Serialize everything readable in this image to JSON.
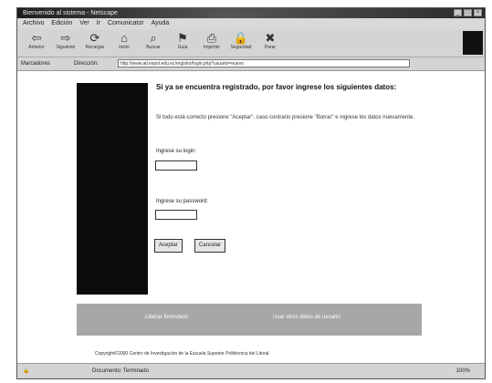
{
  "window": {
    "title": "Bienvenido al sistema - Netscape"
  },
  "menu": [
    "Archivo",
    "Edición",
    "Ver",
    "Ir",
    "Comunicator",
    "Ayuda"
  ],
  "toolbar": [
    {
      "icon": "back-icon",
      "label": "Anterior",
      "glyph": "⇦"
    },
    {
      "icon": "forward-icon",
      "label": "Siguiente",
      "glyph": "⇨"
    },
    {
      "icon": "reload-icon",
      "label": "Recargar",
      "glyph": "⟳"
    },
    {
      "icon": "home-icon",
      "label": "Inicio",
      "glyph": "⌂"
    },
    {
      "icon": "search-icon",
      "label": "Buscar",
      "glyph": "⌕"
    },
    {
      "icon": "guide-icon",
      "label": "Guía",
      "glyph": "⚑"
    },
    {
      "icon": "print-icon",
      "label": "Imprimir",
      "glyph": "⎙"
    },
    {
      "icon": "security-icon",
      "label": "Seguridad",
      "glyph": "🔒"
    },
    {
      "icon": "stop-icon",
      "label": "Parar",
      "glyph": "✖"
    }
  ],
  "linksbar": {
    "bookmarks_label": "Marcadores",
    "location_label": "Dirección:",
    "url": "http://www.ati.espol.edu.ec/registro/login.php?usuario=nuevo"
  },
  "page": {
    "heading": "Si ya se encuentra registrado, por favor ingrese los siguientes datos:",
    "description": "Si todo está correcto presione \"Aceptar\", caso contrario presione \"Borrar\" e ingrese los datos nuevamente.",
    "user_label": "Ingrese su login:",
    "password_label": "Ingrese su password:",
    "accept_label": "Aceptar",
    "cancel_label": "Cancelar",
    "footer_link_1": "Liberar formulario",
    "footer_link_2": "Usar otros datos de usuario",
    "copyright": "Copyright©2000 Centro de Investigación de la Escuela Superior Politécnica del Litoral"
  },
  "status": {
    "text": "Documento: Terminado",
    "zoom": "100%"
  }
}
